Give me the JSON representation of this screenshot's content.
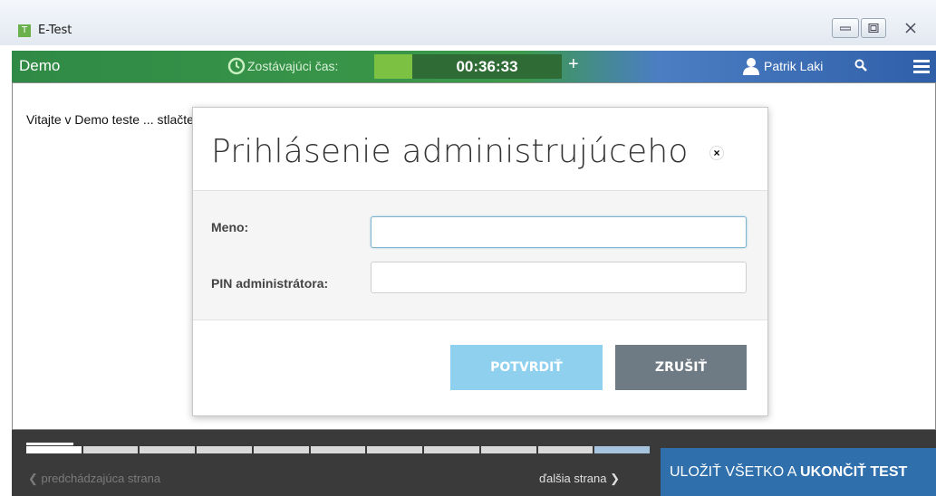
{
  "window": {
    "title": "E-Test",
    "icon_letter": "T"
  },
  "header": {
    "section": "Demo",
    "time_label": "Zostávajúci čas:",
    "time_value": "00:36:33",
    "plus": "+",
    "user_name": "Patrik Laki"
  },
  "content": {
    "intro": "Vitajte v Demo teste ... stlačte tlačidlo \"Ďalšia strana\". Na záver te... tlačidla \"Uložiť všetko a ukončiť test\"."
  },
  "dialog": {
    "title": "Prihlásenie administrujúceho",
    "name_label": "Meno:",
    "name_value": "",
    "pin_label": "PIN administrátora:",
    "pin_value": "",
    "confirm_label": "POTVRDIŤ",
    "cancel_label": "ZRUŠIŤ"
  },
  "footer": {
    "prev_label": "predchádzajúca strana",
    "next_label": "ďalšia strana",
    "finish_label_part1": "ULOŽIŤ VŠETKO A ",
    "finish_label_part2": "UKONČIŤ TEST",
    "progress_pages_total": 11,
    "progress_current_page": 1
  },
  "colors": {
    "header_green": "#3c9a4a",
    "header_blue": "#2f5fa8",
    "timer_green": "#7dc142",
    "confirm_button": "#8fd0ef",
    "cancel_button": "#6f7b84",
    "finish_button": "#2f6fab",
    "footer_bg": "#3a3a3a"
  }
}
